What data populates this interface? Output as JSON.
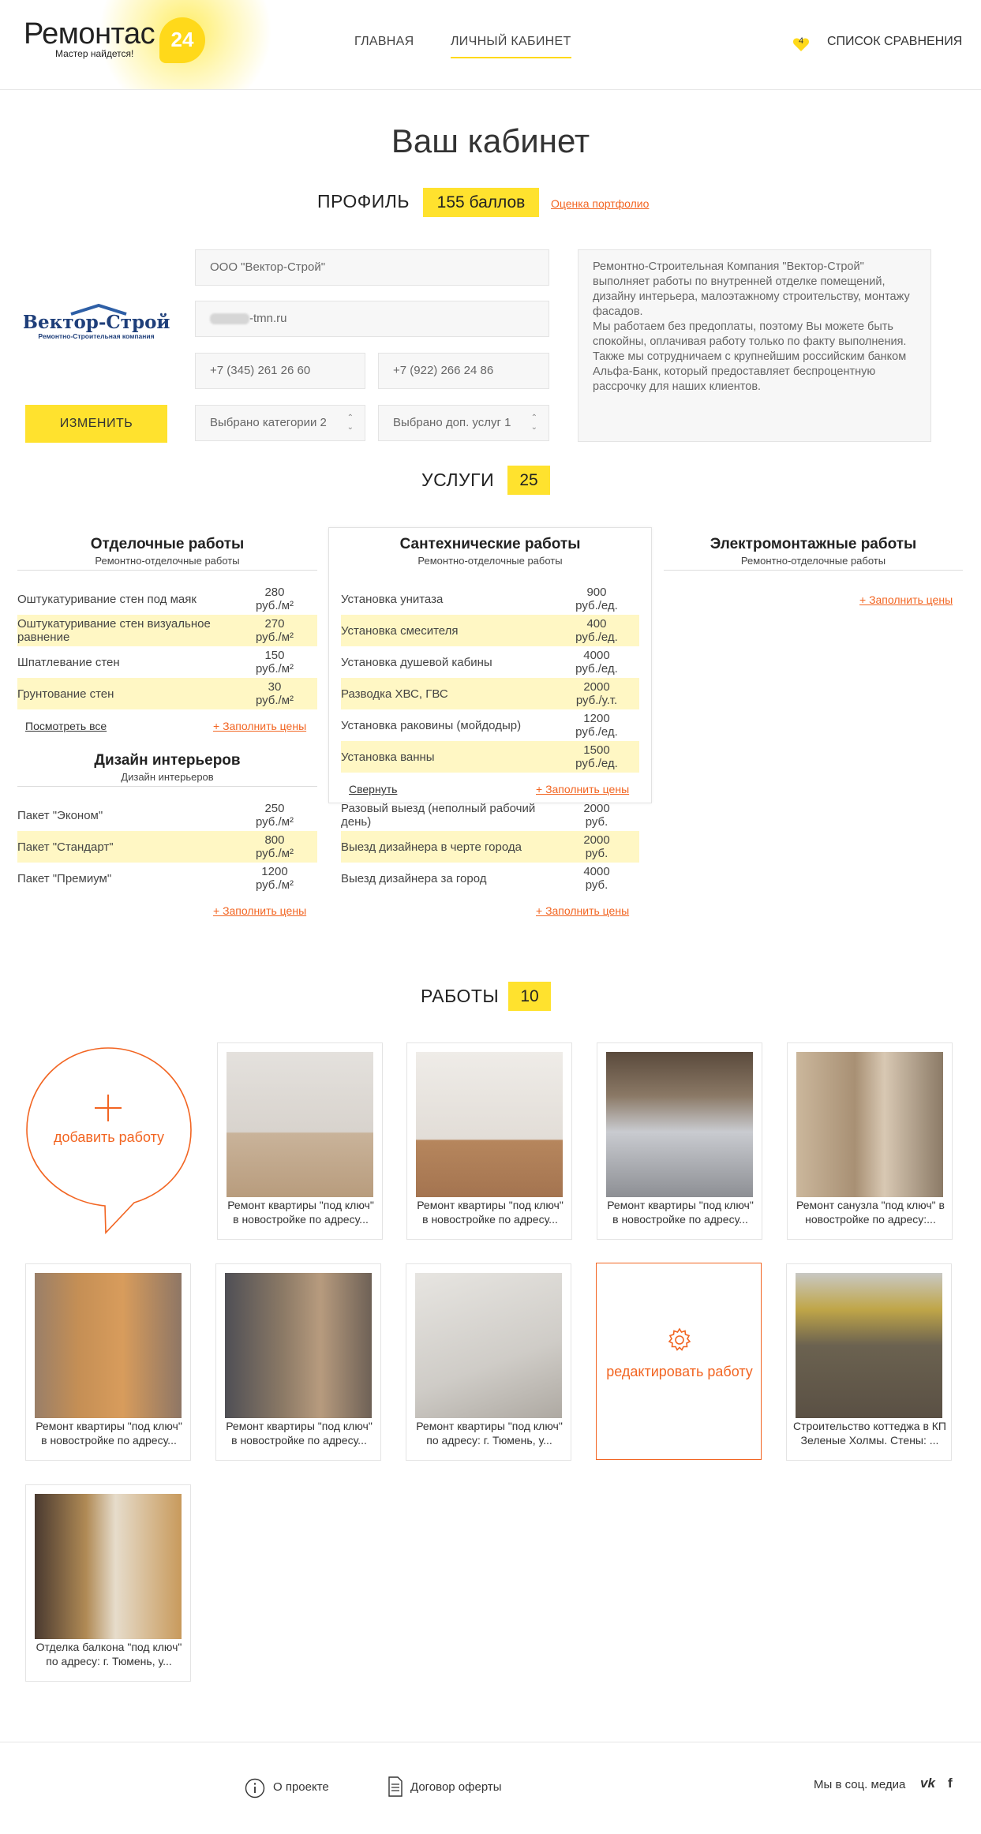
{
  "header": {
    "logo_text": "Ремонтас",
    "logo_number": "24",
    "logo_tagline": "Мастер найдется!",
    "nav": [
      "ГЛАВНАЯ",
      "ЛИЧНЫЙ КАБИНЕТ"
    ],
    "active_nav": "ЛИЧНЫЙ КАБИНЕТ",
    "compare_count": "4",
    "compare_label": "СПИСОК СРАВНЕНИЯ"
  },
  "page_title": "Ваш кабинет",
  "profile": {
    "heading": "ПРОФИЛЬ",
    "points": "155 баллов",
    "portfolio_link": "Оценка портфолио",
    "company_logo_text": "Вектор-Строй",
    "company_logo_sub": "Ремонтно-Строительная компания",
    "edit_button": "ИЗМЕНИТЬ",
    "company_name": "ООО \"Вектор-Строй\"",
    "email_suffix": "-tmn.ru",
    "phone1": "+7 (345) 261 26 60",
    "phone2": "+7 (922) 266 24 86",
    "categories_select": "Выбрано категории 2",
    "extra_services_select": "Выбрано доп. услуг 1",
    "about": "Ремонтно-Строительная Компания \"Вектор-Строй\" выполняет работы по внутренней отделке помещений, дизайну интерьера, малоэтажному строительству, монтажу фасадов.\nМы работаем без предоплаты, поэтому Вы можете быть спокойны, оплачивая работу только по факту выполнения.\nТакже мы сотрудничаем с крупнейшим российским банком Альфа-Банк, который предоставляет беспроцентную рассрочку для наших клиентов."
  },
  "services": {
    "heading": "УСЛУГИ",
    "count": "25",
    "fill_prices": "+ Заполнить цены",
    "view_all": "Посмотреть все",
    "collapse": "Свернуть",
    "columns": {
      "finishing": {
        "title": "Отделочные работы",
        "subtitle": "Ремонтно-отделочные работы",
        "rows": [
          {
            "name": "Оштукатуривание стен под маяк",
            "price": "280",
            "unit": "руб./м²"
          },
          {
            "name": "Оштукатуривание стен визуальное равнение",
            "price": "270",
            "unit": "руб./м²"
          },
          {
            "name": "Шпатлевание стен",
            "price": "150",
            "unit": "руб./м²"
          },
          {
            "name": "Грунтование стен",
            "price": "30",
            "unit": "руб./м²"
          }
        ]
      },
      "design": {
        "title": "Дизайн интерьеров",
        "subtitle": "Дизайн интерьеров",
        "rows": [
          {
            "name": "Пакет \"Эконом\"",
            "price": "250",
            "unit": "руб./м²"
          },
          {
            "name": "Пакет \"Стандарт\"",
            "price": "800",
            "unit": "руб./м²"
          },
          {
            "name": "Пакет \"Премиум\"",
            "price": "1200",
            "unit": "руб./м²"
          }
        ]
      },
      "plumbing": {
        "title": "Сантехнические работы",
        "subtitle": "Ремонтно-отделочные работы",
        "rows": [
          {
            "name": "Установка унитаза",
            "price": "900",
            "unit": "руб./ед."
          },
          {
            "name": "Установка смесителя",
            "price": "400",
            "unit": "руб./ед."
          },
          {
            "name": "Установка душевой кабины",
            "price": "4000",
            "unit": "руб./ед."
          },
          {
            "name": "Разводка ХВС, ГВС",
            "price": "2000",
            "unit": "руб./у.т."
          },
          {
            "name": "Установка раковины (мойдодыр)",
            "price": "1200",
            "unit": "руб./ед."
          },
          {
            "name": "Установка ванны",
            "price": "1500",
            "unit": "руб./ед."
          }
        ]
      },
      "visits": {
        "rows": [
          {
            "name": "Разовый выезд (неполный рабочий день)",
            "price": "2000",
            "unit": "руб."
          },
          {
            "name": "Выезд дизайнера в черте города",
            "price": "2000",
            "unit": "руб."
          },
          {
            "name": "Выезд дизайнера за город",
            "price": "4000",
            "unit": "руб."
          }
        ]
      },
      "electrical": {
        "title": "Электромонтажные работы",
        "subtitle": "Ремонтно-отделочные работы"
      }
    }
  },
  "works": {
    "heading": "РАБОТЫ",
    "count": "10",
    "add_label": "добавить работу",
    "edit_label": "редактировать работу",
    "items": [
      {
        "caption": "Ремонт квартиры \"под ключ\" в новостройке по адресу..."
      },
      {
        "caption": "Ремонт квартиры \"под ключ\" в новостройке по адресу..."
      },
      {
        "caption": "Ремонт квартиры \"под ключ\" в новостройке по адресу..."
      },
      {
        "caption": "Ремонт санузла \"под ключ\" в новостройке по адресу:..."
      },
      {
        "caption": "Ремонт квартиры \"под ключ\" в новостройке по адресу..."
      },
      {
        "caption": "Ремонт квартиры \"под ключ\" в новостройке по адресу..."
      },
      {
        "caption": "Ремонт квартиры \"под ключ\" по адресу: г. Тюмень, у..."
      },
      {
        "caption": "Строительство коттеджа в КП Зеленые Холмы. Стены: ..."
      },
      {
        "caption": "Отделка балкона \"под ключ\" по адресу: г. Тюмень, у..."
      }
    ]
  },
  "footer": {
    "about": "О проекте",
    "offer": "Договор оферты",
    "social_label": "Мы в соц. медиа",
    "vk": "vk",
    "fb": "f"
  },
  "colors": {
    "accent": "#ffe22e",
    "link": "#f26522",
    "highlight_row": "#fff7c4"
  }
}
